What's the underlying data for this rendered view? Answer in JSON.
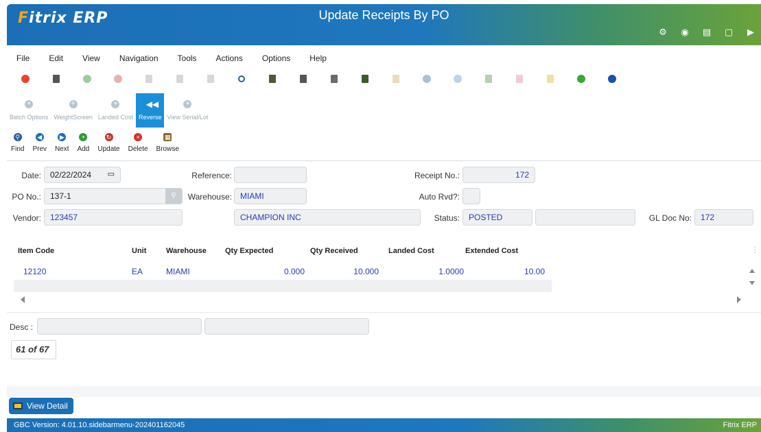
{
  "app": {
    "logo": "FITRIX ERP",
    "title": "Update Receipts By PO"
  },
  "header_icons": [
    "gear-icon",
    "globe-icon",
    "document-icon",
    "page-icon",
    "play-icon"
  ],
  "menu": [
    "File",
    "Edit",
    "View",
    "Navigation",
    "Tools",
    "Actions",
    "Options",
    "Help"
  ],
  "action_buttons": [
    {
      "label": "Batch Options",
      "active": false
    },
    {
      "label": "WeightScreen",
      "active": false
    },
    {
      "label": "Landed Cost",
      "active": false
    },
    {
      "label": "Reverse",
      "active": true
    },
    {
      "label": "View Serial/Lot",
      "active": false
    }
  ],
  "nav_buttons": [
    {
      "label": "Find",
      "icon": "search-icon",
      "color": "#2a5d9f"
    },
    {
      "label": "Prev",
      "icon": "prev-icon",
      "color": "#1b6fb6"
    },
    {
      "label": "Next",
      "icon": "next-icon",
      "color": "#1b6fb6"
    },
    {
      "label": "Add",
      "icon": "add-icon",
      "color": "#2e9a3a"
    },
    {
      "label": "Update",
      "icon": "update-icon",
      "color": "#c0392b"
    },
    {
      "label": "Delete",
      "icon": "delete-icon",
      "color": "#d93025"
    },
    {
      "label": "Browse",
      "icon": "browse-icon",
      "color": "#8a6d3b"
    }
  ],
  "form": {
    "date_label": "Date:",
    "date_value": "02/22/2024",
    "reference_label": "Reference:",
    "reference_value": "",
    "receipt_no_label": "Receipt No.:",
    "receipt_no_value": "172",
    "po_no_label": "PO No.:",
    "po_no_value": "137-1",
    "warehouse_label": "Warehouse:",
    "warehouse_value": "MIAMI",
    "auto_rvd_label": "Auto Rvd?:",
    "auto_rvd_value": "",
    "vendor_label": "Vendor:",
    "vendor_value": "123457",
    "vendor_name": "CHAMPION INC",
    "status_label": "Status:",
    "status_value": "POSTED",
    "status_extra": "",
    "gl_doc_label": "GL Doc No:",
    "gl_doc_value": "172"
  },
  "grid": {
    "columns": [
      "Item Code",
      "Unit",
      "Warehouse",
      "Qty Expected",
      "Qty Received",
      "Landed Cost",
      "Extended Cost"
    ],
    "rows": [
      [
        "12120",
        "EA",
        "MIAMI",
        "0.000",
        "10.000",
        "1.0000",
        "10.00"
      ]
    ]
  },
  "desc": {
    "label": "Desc :",
    "value1": "",
    "value2": ""
  },
  "record_count": "61 of 67",
  "view_detail_label": "View Detail",
  "status_bar": {
    "version": "GBC Version: 4.01.10.sidebarmenu-202401162045",
    "brand": "Fitrix ERP"
  },
  "colors": {
    "accent_blue": "#1b6fb6",
    "brand_green": "#6aa33a",
    "value_blue": "#2b3ab8"
  }
}
